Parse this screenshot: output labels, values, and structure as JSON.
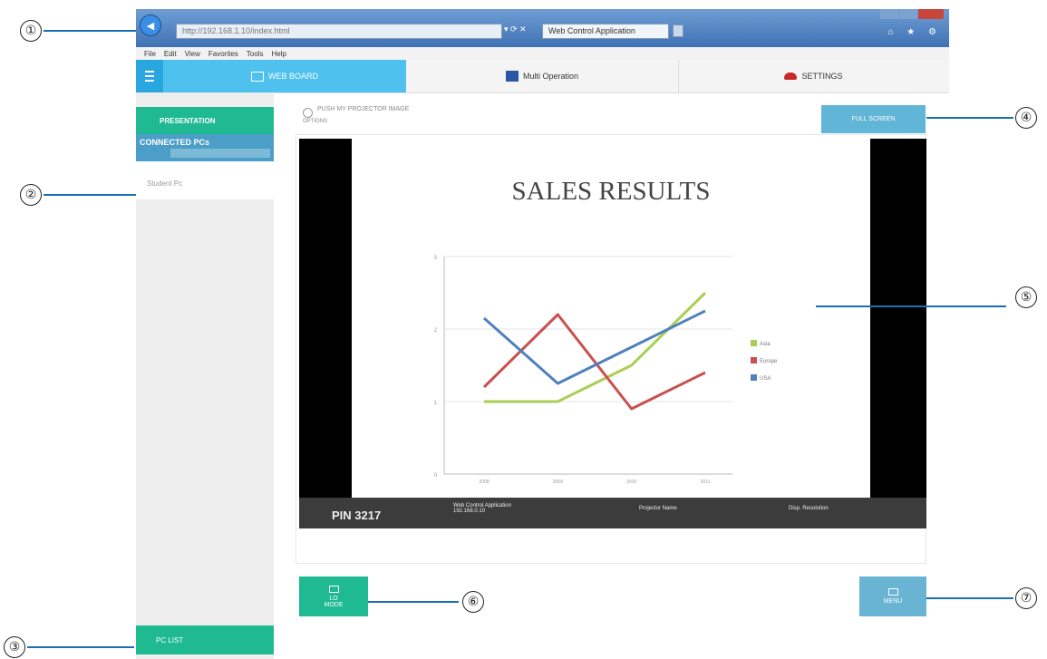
{
  "callouts": [
    "①",
    "②",
    "③",
    "④",
    "⑤",
    "⑥",
    "⑦"
  ],
  "browser": {
    "nav_icon": "back-arrow-icon",
    "address": "http://192.168.1.10/index.html",
    "address_controls": "▾ ⟳ ✕",
    "tab_title": "Web Control Application",
    "tool_icons": "⌂ ★ ⚙"
  },
  "menubar": [
    "File",
    "Edit",
    "View",
    "Favorites",
    "Tools",
    "Help"
  ],
  "topnav": {
    "tab_board": "WEB BOARD",
    "tab_multi": "Multi Operation",
    "tab_settings": "SETTINGS"
  },
  "sidebar": {
    "green_label": "PRESENTATION",
    "blue_title": "CONNECTED PCs",
    "blue_sub": "",
    "white_item": "Student Pc",
    "bottom_label": "PC LIST"
  },
  "main": {
    "radio_label": "PUSH MY PROJECTOR IMAGE",
    "sub_label": "OPTIONS",
    "top_right_button": "FULL SCREEN",
    "left_button": "LO\nMODE",
    "right_button": "MENU"
  },
  "slide": {
    "title": "SALES RESULTS",
    "pin": "PIN 3217",
    "info1_line1": "Web Control Application",
    "info1_line2": "192.168.0.10",
    "info2": "Projector Name",
    "info3": "Disp. Resolution"
  },
  "chart_data": {
    "type": "line",
    "categories": [
      "2008",
      "2009",
      "2010",
      "2011"
    ],
    "ylim": [
      0,
      3
    ],
    "yticks": [
      "0",
      "1",
      "2",
      "3"
    ],
    "series": [
      {
        "name": "Asia",
        "color": "#a9cf54",
        "values": [
          1.0,
          1.0,
          1.5,
          2.5
        ]
      },
      {
        "name": "Europe",
        "color": "#c9504f",
        "values": [
          1.2,
          2.2,
          0.9,
          1.4
        ]
      },
      {
        "name": "USA",
        "color": "#4f81bd",
        "values": [
          2.15,
          1.25,
          1.75,
          2.25
        ]
      }
    ],
    "gridlines": true,
    "legend_position": "right"
  }
}
